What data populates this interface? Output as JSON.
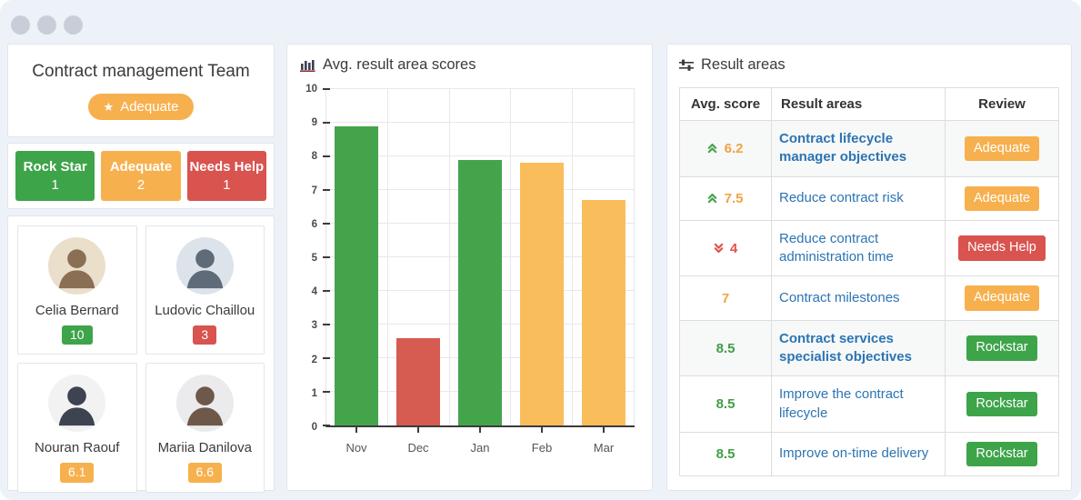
{
  "window": {
    "dots_count": 3
  },
  "palette": {
    "green": "#3EA44A",
    "orange": "#F7B04E",
    "red": "#D9534F",
    "score_green": "#3F9F47",
    "score_orange": "#F0A345",
    "score_red": "#E0544A",
    "trend_up_green": "#4AA34E",
    "trend_down_red": "#E0544A",
    "link_blue": "#2C74B3"
  },
  "team_panel": {
    "title": "Contract management Team",
    "badge": {
      "icon": "star",
      "label": "Adequate",
      "level": "orange"
    },
    "stats": [
      {
        "label": "Rock Star",
        "count": "1",
        "level": "green"
      },
      {
        "label": "Adequate",
        "count": "2",
        "level": "orange"
      },
      {
        "label": "Needs Help",
        "count": "1",
        "level": "red"
      }
    ],
    "members": [
      {
        "name": "Celia Bernard",
        "score": "10",
        "score_level": "green",
        "avatar_bg": "#EADFCB",
        "avatar_fg": "#8A6F55"
      },
      {
        "name": "Ludovic Chaillou",
        "score": "3",
        "score_level": "red",
        "avatar_bg": "#DCE3EA",
        "avatar_fg": "#5F6B78"
      },
      {
        "name": "Nouran Raouf",
        "score": "6.1",
        "score_level": "orange",
        "avatar_bg": "#F2F2F3",
        "avatar_fg": "#3D4350"
      },
      {
        "name": "Mariia Danilova",
        "score": "6.6",
        "score_level": "orange",
        "avatar_bg": "#EBEBEE",
        "avatar_fg": "#6E584A"
      }
    ]
  },
  "chart_panel": {
    "title": "Avg. result area scores",
    "icon": "bar-chart-icon",
    "chart_data": {
      "type": "bar",
      "title": "Avg. result area scores",
      "categories": [
        "Nov",
        "Dec",
        "Jan",
        "Feb",
        "Mar"
      ],
      "values": [
        8.9,
        2.6,
        7.9,
        7.8,
        6.7
      ],
      "bar_colors": [
        "#44A44B",
        "#D65B50",
        "#44A44B",
        "#FABD5C",
        "#FABD5C"
      ],
      "xlabel": "",
      "ylabel": "",
      "ylim": [
        0,
        10
      ],
      "yticks": [
        0,
        1,
        2,
        3,
        4,
        5,
        6,
        7,
        8,
        9,
        10
      ],
      "grid": "both",
      "legend": "none"
    }
  },
  "result_areas_panel": {
    "title": "Result areas",
    "icon": "sliders-icon",
    "table": {
      "headers": [
        "Avg. score",
        "Result areas",
        "Review"
      ],
      "rows": [
        {
          "score": "6.2",
          "trend": "up",
          "score_level": "orange",
          "area": "Contract lifecycle manager objectives",
          "emphasis": true,
          "review": "Adequate",
          "review_level": "orange",
          "shaded": true
        },
        {
          "score": "7.5",
          "trend": "up",
          "score_level": "orange",
          "area": "Reduce contract risk",
          "emphasis": false,
          "review": "Adequate",
          "review_level": "orange",
          "shaded": false
        },
        {
          "score": "4",
          "trend": "down",
          "score_level": "red",
          "area": "Reduce contract administration time",
          "emphasis": false,
          "review": "Needs Help",
          "review_level": "red",
          "shaded": false
        },
        {
          "score": "7",
          "trend": "none",
          "score_level": "orange",
          "area": "Contract milestones",
          "emphasis": false,
          "review": "Adequate",
          "review_level": "orange",
          "shaded": false
        },
        {
          "score": "8.5",
          "trend": "none",
          "score_level": "green",
          "area": "Contract services specialist objectives",
          "emphasis": true,
          "review": "Rockstar",
          "review_level": "green",
          "shaded": true
        },
        {
          "score": "8.5",
          "trend": "none",
          "score_level": "green",
          "area": "Improve the contract lifecycle",
          "emphasis": false,
          "review": "Rockstar",
          "review_level": "green",
          "shaded": false
        },
        {
          "score": "8.5",
          "trend": "none",
          "score_level": "green",
          "area": "Improve on-time delivery",
          "emphasis": false,
          "review": "Rockstar",
          "review_level": "green",
          "shaded": false
        }
      ]
    }
  }
}
